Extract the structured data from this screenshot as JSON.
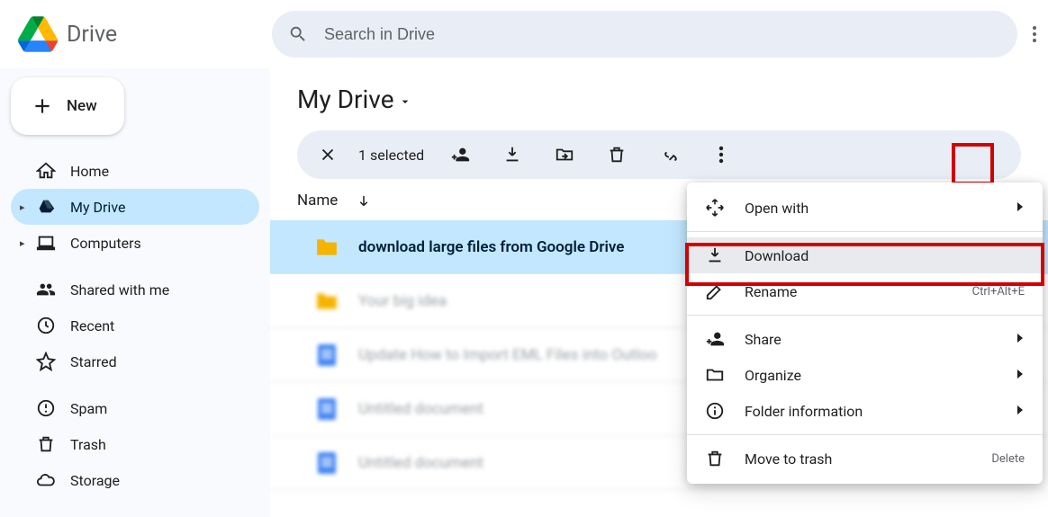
{
  "header": {
    "app_name": "Drive",
    "search_placeholder": "Search in Drive"
  },
  "sidebar": {
    "new_label": "New",
    "items": [
      {
        "label": "Home"
      },
      {
        "label": "My Drive"
      },
      {
        "label": "Computers"
      },
      {
        "label": "Shared with me"
      },
      {
        "label": "Recent"
      },
      {
        "label": "Starred"
      },
      {
        "label": "Spam"
      },
      {
        "label": "Trash"
      },
      {
        "label": "Storage"
      }
    ]
  },
  "main": {
    "breadcrumb": "My Drive",
    "selection_text": "1 selected",
    "name_col": "Name",
    "files": [
      {
        "name": "download large files from Google Drive"
      },
      {
        "name": "Your big idea"
      },
      {
        "name": "Update How to Import EML Files into Outloo"
      },
      {
        "name": "Untitled document"
      },
      {
        "name": "Untitled document"
      }
    ],
    "context_menu": {
      "open_with": "Open with",
      "download": "Download",
      "rename": "Rename",
      "rename_shortcut": "Ctrl+Alt+E",
      "share": "Share",
      "organize": "Organize",
      "folder_info": "Folder information",
      "move_to_trash": "Move to trash",
      "delete_shortcut": "Delete"
    }
  }
}
